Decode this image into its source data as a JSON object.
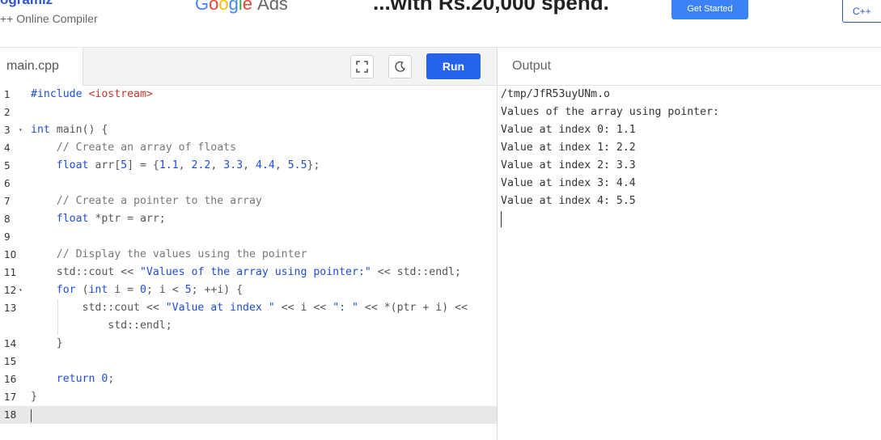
{
  "header": {
    "brand_name": "ogramiz",
    "brand_sub": "++ Online Compiler",
    "ad_google_letters": [
      "G",
      "o",
      "o",
      "g",
      "l",
      "e"
    ],
    "ad_google_ads": "Ads",
    "ad_tagline": "...with Rs.20,000 spend.",
    "ad_cta": "Get Started",
    "lang_label": "C++"
  },
  "editor": {
    "file_tab": "main.cpp",
    "fullscreen_icon": "fullscreen-icon",
    "theme_icon": "moon-icon",
    "run_label": "Run",
    "lines": [
      {
        "n": "1",
        "tokens": [
          {
            "t": "#include ",
            "c": "kw"
          },
          {
            "t": "<iostream>",
            "c": "inc"
          }
        ]
      },
      {
        "n": "2",
        "tokens": []
      },
      {
        "n": "3",
        "fold": true,
        "tokens": [
          {
            "t": "int",
            "c": "kw"
          },
          {
            "t": " main() {",
            "c": ""
          }
        ]
      },
      {
        "n": "4",
        "tokens": [
          {
            "t": "    // Create an array of floats",
            "c": "cmt"
          }
        ]
      },
      {
        "n": "5",
        "tokens": [
          {
            "t": "    ",
            "c": ""
          },
          {
            "t": "float",
            "c": "kw"
          },
          {
            "t": " arr[",
            "c": ""
          },
          {
            "t": "5",
            "c": "num"
          },
          {
            "t": "] = {",
            "c": ""
          },
          {
            "t": "1.1",
            "c": "num"
          },
          {
            "t": ", ",
            "c": ""
          },
          {
            "t": "2.2",
            "c": "num"
          },
          {
            "t": ", ",
            "c": ""
          },
          {
            "t": "3.3",
            "c": "num"
          },
          {
            "t": ", ",
            "c": ""
          },
          {
            "t": "4.4",
            "c": "num"
          },
          {
            "t": ", ",
            "c": ""
          },
          {
            "t": "5.5",
            "c": "num"
          },
          {
            "t": "};",
            "c": ""
          }
        ]
      },
      {
        "n": "6",
        "tokens": []
      },
      {
        "n": "7",
        "tokens": [
          {
            "t": "    // Create a pointer to the array",
            "c": "cmt"
          }
        ]
      },
      {
        "n": "8",
        "tokens": [
          {
            "t": "    ",
            "c": ""
          },
          {
            "t": "float",
            "c": "kw"
          },
          {
            "t": " *ptr = arr;",
            "c": ""
          }
        ]
      },
      {
        "n": "9",
        "tokens": []
      },
      {
        "n": "10",
        "tokens": [
          {
            "t": "    // Display the values using the pointer",
            "c": "cmt"
          }
        ]
      },
      {
        "n": "11",
        "tokens": [
          {
            "t": "    std::cout << ",
            "c": ""
          },
          {
            "t": "\"Values of the array using pointer:\"",
            "c": "str"
          },
          {
            "t": " << std::endl;",
            "c": ""
          }
        ]
      },
      {
        "n": "12",
        "fold": true,
        "tokens": [
          {
            "t": "    ",
            "c": ""
          },
          {
            "t": "for",
            "c": "kw"
          },
          {
            "t": " (",
            "c": ""
          },
          {
            "t": "int",
            "c": "kw"
          },
          {
            "t": " i = ",
            "c": ""
          },
          {
            "t": "0",
            "c": "num"
          },
          {
            "t": "; i < ",
            "c": ""
          },
          {
            "t": "5",
            "c": "num"
          },
          {
            "t": "; ++i) {",
            "c": ""
          }
        ]
      },
      {
        "n": "13",
        "tokens": [
          {
            "t": "        std::cout << ",
            "c": ""
          },
          {
            "t": "\"Value at index \"",
            "c": "str"
          },
          {
            "t": " << i << ",
            "c": ""
          },
          {
            "t": "\": \"",
            "c": "str"
          },
          {
            "t": " << *(ptr + i) <<",
            "c": ""
          }
        ],
        "cont": "            std::endl;"
      },
      {
        "n": "14",
        "tokens": [
          {
            "t": "    }",
            "c": ""
          }
        ]
      },
      {
        "n": "15",
        "tokens": []
      },
      {
        "n": "16",
        "tokens": [
          {
            "t": "    ",
            "c": ""
          },
          {
            "t": "return",
            "c": "kw"
          },
          {
            "t": " ",
            "c": ""
          },
          {
            "t": "0",
            "c": "num"
          },
          {
            "t": ";",
            "c": ""
          }
        ]
      },
      {
        "n": "17",
        "tokens": [
          {
            "t": "}",
            "c": ""
          }
        ]
      },
      {
        "n": "18",
        "tokens": [],
        "active": true
      }
    ]
  },
  "output": {
    "title": "Output",
    "lines": [
      "/tmp/JfR53uyUNm.o",
      "Values of the array using pointer:",
      "Value at index 0: 1.1",
      "Value at index 1: 2.2",
      "Value at index 2: 3.3",
      "Value at index 3: 4.4",
      "Value at index 4: 5.5"
    ]
  }
}
